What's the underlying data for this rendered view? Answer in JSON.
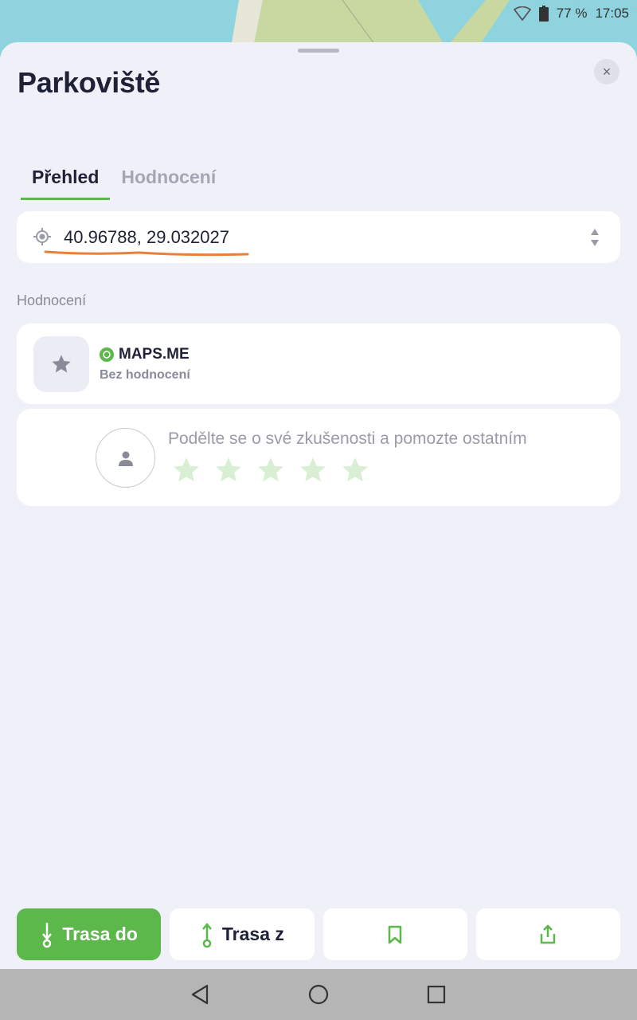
{
  "status_bar": {
    "battery": "77 %",
    "time": "17:05"
  },
  "sheet": {
    "title": "Parkoviště",
    "close_symbol": "×"
  },
  "tabs": [
    {
      "label": "Přehled",
      "active": true
    },
    {
      "label": "Hodnocení",
      "active": false
    }
  ],
  "coordinates": {
    "value": "40.96788, 29.032027"
  },
  "ratings_section": {
    "label": "Hodnocení",
    "source_name": "MAPS.ME",
    "source_status": "Bez hodnocení"
  },
  "share": {
    "prompt": "Podělte se o své zkušenosti a pomozte ostatním",
    "star_count": 5
  },
  "actions": {
    "route_to": "Trasa do",
    "route_from": "Trasa z"
  },
  "icons": [
    "location-target-icon",
    "sort-arrows-icon",
    "star-icon",
    "user-icon",
    "route-to-icon",
    "route-from-icon",
    "bookmark-icon",
    "share-icon",
    "back-icon",
    "home-icon",
    "recents-icon",
    "close-icon",
    "wifi-icon",
    "battery-icon"
  ],
  "colors": {
    "accent": "#5cb84a",
    "underline": "#e8803a",
    "text": "#1f2137",
    "muted": "#8a8b99",
    "background": "#f0f0f8"
  }
}
